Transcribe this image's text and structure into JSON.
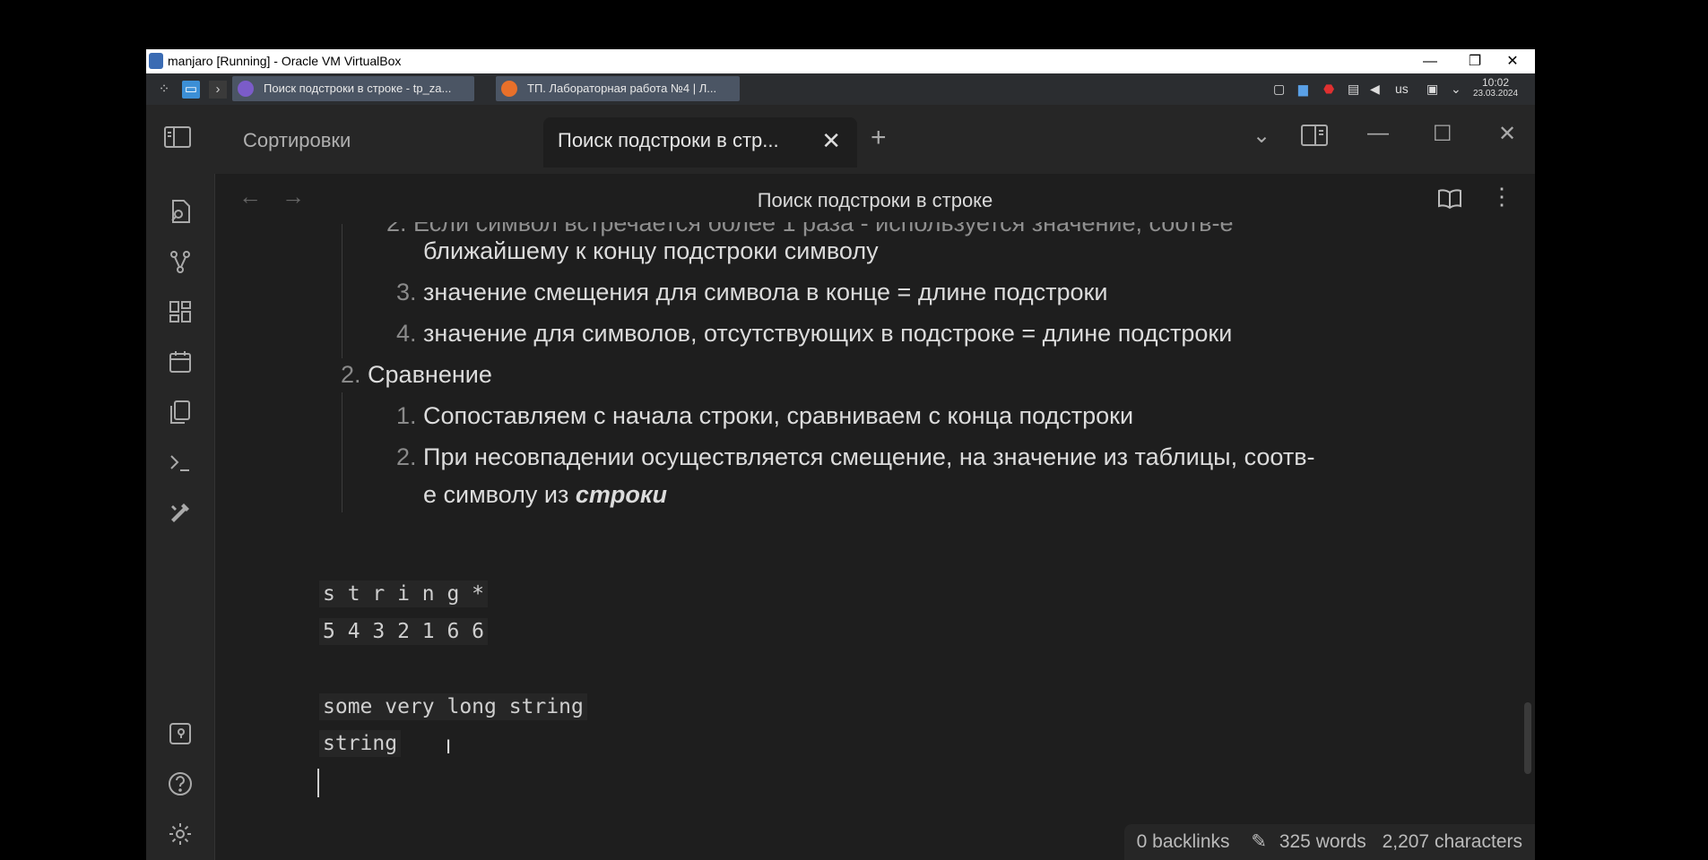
{
  "vbox": {
    "title": "manjaro [Running] - Oracle VM VirtualBox",
    "minimize": "—",
    "restore": "❐",
    "close": "✕"
  },
  "taskbar": {
    "tasks": [
      {
        "label": "Поиск подстроки в строке - tp_za..."
      },
      {
        "label": "ТП. Лабораторная работа №4 | Л..."
      }
    ],
    "keyboard_layout": "us",
    "clock_time": "10:02",
    "clock_date": "23.03.2024"
  },
  "tabs": [
    {
      "label": "Сортировки"
    },
    {
      "label": "Поиск подстроки в стр..."
    }
  ],
  "view": {
    "title": "Поиск подстроки в строке"
  },
  "content": {
    "partial_top": "2. Если символ встречается более 1 раза - используется значение, соотв-е",
    "line1": "ближайшему к концу подстроки символу",
    "item3_num": "3.",
    "item3": "значение смещения для символа в конце = длине подстроки",
    "item4_num": "4.",
    "item4": "значение для символов, отсутствующих в подстроке = длине подстроки",
    "section2_num": "2.",
    "section2": "Сравнение",
    "sub1_num": "1.",
    "sub1": "Сопоставляем с начала строки, сравниваем с конца подстроки",
    "sub2_num": "2.",
    "sub2": "При несовпадении осуществляется смещение, на значение из таблицы, соотв-",
    "sub2_cont": "е символу из ",
    "sub2_bold": "строки",
    "code1_line1": "s t r i n g *",
    "code1_line2": "5 4 3 2 1 6 6",
    "code2_line1": "some very long string",
    "code2_line2": "string"
  },
  "status": {
    "backlinks": "0 backlinks",
    "words": "325 words",
    "characters": "2,207 characters"
  }
}
